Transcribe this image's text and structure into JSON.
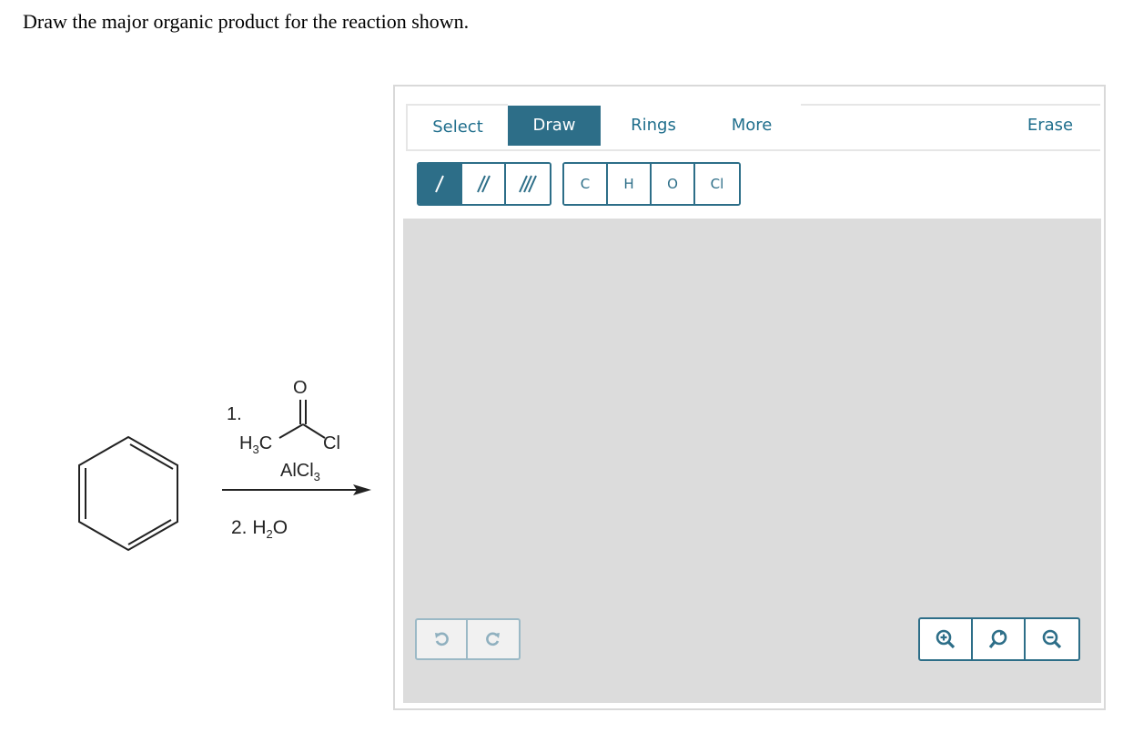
{
  "question": "Draw the major organic product for the reaction shown.",
  "reaction": {
    "step1_label": "1.",
    "reagent_left": "H",
    "reagent_left_sub": "3",
    "reagent_left_tail": "C",
    "reagent_right": "Cl",
    "reagent_oxygen": "O",
    "catalyst": "AlCl",
    "catalyst_sub": "3",
    "step2_label": "2. H",
    "step2_sub": "2",
    "step2_tail": "O"
  },
  "editor": {
    "tabs": {
      "select": "Select",
      "draw": "Draw",
      "rings": "Rings",
      "more": "More",
      "erase": "Erase"
    },
    "bond_tools": [
      "single-bond",
      "double-bond",
      "triple-bond"
    ],
    "atoms": [
      "C",
      "H",
      "O",
      "Cl"
    ],
    "accent_color": "#2d6e88",
    "canvas_color": "#dcdcdc"
  }
}
